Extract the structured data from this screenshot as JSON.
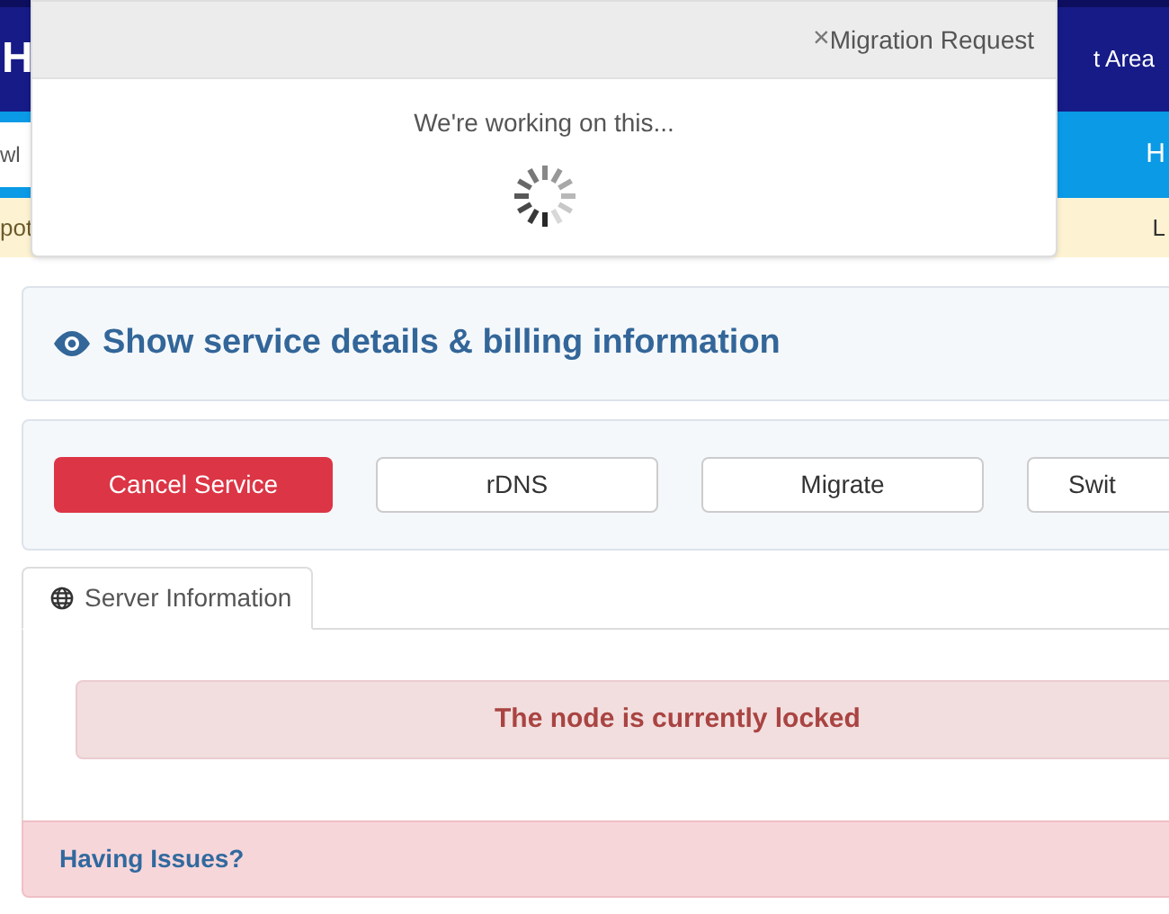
{
  "header": {
    "logo": "H",
    "nav_link": "t Area"
  },
  "nav_bar": {
    "search_value": "wl",
    "menu_item": "H"
  },
  "notice_bar": {
    "left_text": "pot",
    "right_text": "L"
  },
  "modal": {
    "close": "×",
    "title": "Migration Request",
    "message": "We're working on this..."
  },
  "details_toggle": {
    "label": "Show service details & billing information"
  },
  "actions": [
    {
      "label": "Cancel Service",
      "kind": "danger"
    },
    {
      "label": "rDNS",
      "kind": "default"
    },
    {
      "label": "Migrate",
      "kind": "default"
    },
    {
      "label": "Swit",
      "kind": "default"
    }
  ],
  "tabs": [
    {
      "label": "Server Information",
      "selected": true
    }
  ],
  "alert": {
    "message": "The node is currently locked"
  },
  "footer_panel": {
    "title": "Having Issues?"
  }
}
